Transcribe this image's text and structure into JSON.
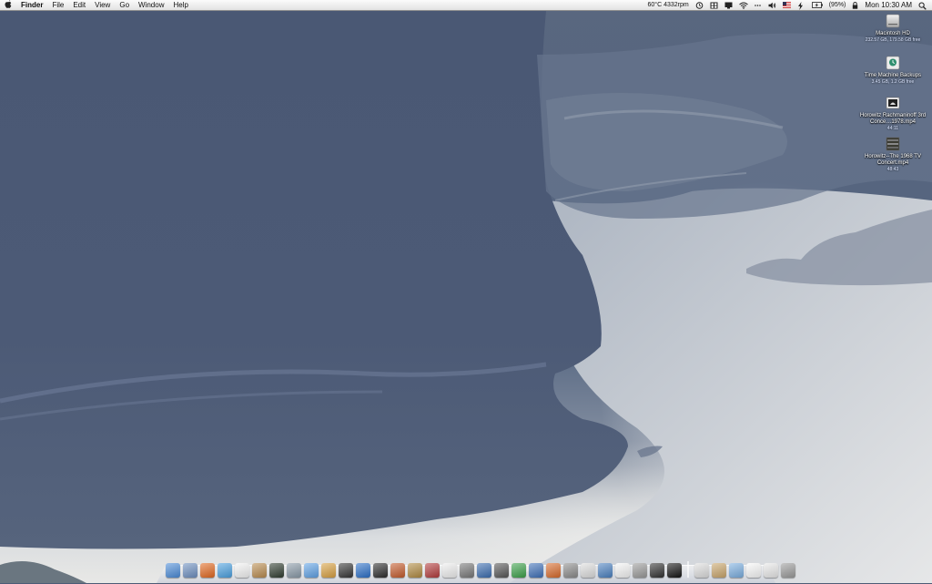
{
  "menubar": {
    "apple_icon": "apple-icon",
    "app_name": "Finder",
    "menus": [
      "File",
      "Edit",
      "View",
      "Go",
      "Window",
      "Help"
    ],
    "status": {
      "temp_fan": "60°C 4332rpm",
      "battery_percent": "(95%)",
      "clock": "Mon 10:30 AM"
    },
    "status_icons": [
      "time-machine-icon",
      "spaces-icon",
      "display-icon",
      "wifi-icon",
      "bluetooth-icon",
      "volume-icon",
      "flag-icon",
      "power-icon",
      "battery-icon",
      "lock-icon",
      "spotlight-icon"
    ]
  },
  "desktop": {
    "items": [
      {
        "name": "Macintosh HD",
        "info": "232.57 GB, 179.58 GB free",
        "icon": "hard-drive-icon"
      },
      {
        "name": "Time Machine Backups",
        "info": "3.45 GB, 1.2 GB free",
        "icon": "time-machine-drive-icon"
      },
      {
        "name": "Horowitz Rachmaninoff 3rd Conce…1978.mp4",
        "info": "44:11",
        "icon": "video-file-icon"
      },
      {
        "name": "Horowitz--The 1968 TV Concert.mp4",
        "info": "48:43",
        "icon": "video-file-icon"
      }
    ]
  },
  "dock": {
    "apps": [
      {
        "name": "finder-icon",
        "color": "#4a8bd8"
      },
      {
        "name": "mail-icon",
        "color": "#6d8fc0"
      },
      {
        "name": "firefox-icon",
        "color": "#e2681f"
      },
      {
        "name": "safari-icon",
        "color": "#4aa0e0"
      },
      {
        "name": "calendar-icon",
        "color": "#f3f3f3"
      },
      {
        "name": "address-book-icon",
        "color": "#b98b4e"
      },
      {
        "name": "activity-monitor-icon",
        "color": "#2e3b2e"
      },
      {
        "name": "preview-icon",
        "color": "#8a9aa8"
      },
      {
        "name": "itunes-icon",
        "color": "#5fa2e6"
      },
      {
        "name": "iphoto-icon",
        "color": "#d8a040"
      },
      {
        "name": "imovie-icon",
        "color": "#333333"
      },
      {
        "name": "dashboard-icon",
        "color": "#2a6fc8"
      },
      {
        "name": "itunes-radio-icon",
        "color": "#2b2b2b"
      },
      {
        "name": "photo-booth-icon",
        "color": "#c45a2a"
      },
      {
        "name": "compass-icon",
        "color": "#b08a40"
      },
      {
        "name": "dictionary-icon",
        "color": "#b33b3b"
      },
      {
        "name": "textedit-icon",
        "color": "#eeeeee"
      },
      {
        "name": "system-preferences-icon",
        "color": "#777777"
      },
      {
        "name": "xcode-icon",
        "color": "#3a6cb0"
      },
      {
        "name": "pen-icon",
        "color": "#555555"
      },
      {
        "name": "numbers-icon",
        "color": "#3aa048"
      },
      {
        "name": "keynote-icon",
        "color": "#3d6fb8"
      },
      {
        "name": "presentation-icon",
        "color": "#d86a2a"
      },
      {
        "name": "printer-icon",
        "color": "#8a8a8a"
      },
      {
        "name": "script-editor-icon",
        "color": "#dddddd"
      },
      {
        "name": "utility-icon",
        "color": "#4a80c0"
      },
      {
        "name": "x11-icon",
        "color": "#f4f4f4"
      },
      {
        "name": "tools-icon",
        "color": "#999999"
      },
      {
        "name": "console-icon",
        "color": "#2f2f2f"
      },
      {
        "name": "terminal-icon",
        "color": "#111111"
      }
    ],
    "stacks": [
      {
        "name": "calculator-icon",
        "color": "#dddddd"
      },
      {
        "name": "documents-stack-icon",
        "color": "#c9a56a"
      },
      {
        "name": "downloads-folder-icon",
        "color": "#7aaee0"
      },
      {
        "name": "document-icon",
        "color": "#f8f8f8"
      },
      {
        "name": "document-stack-icon",
        "color": "#e8e8e8"
      },
      {
        "name": "trash-icon",
        "color": "#9a9a9a"
      }
    ]
  }
}
